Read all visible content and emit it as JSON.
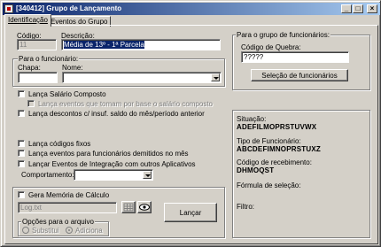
{
  "window": {
    "title": "[340412] Grupo de Lançamento",
    "minimize_symbol": "_",
    "maximize_symbol": "□",
    "close_symbol": "×"
  },
  "tabs": [
    {
      "label": "Identificação"
    },
    {
      "label": "Eventos do Grupo"
    }
  ],
  "form": {
    "codigo_label": "Código:",
    "codigo_value": "11",
    "descricao_label": "Descrição:",
    "descricao_value": "Média de 13º - 1ª Parcela",
    "funcionario_group_title": "Para o funcionário:",
    "chapa_label": "Chapa:",
    "chapa_value": "",
    "nome_label": "Nome:",
    "nome_value": ""
  },
  "checks": {
    "salario_composto": "Lança Salário Composto",
    "eventos_base": "Lança eventos que tomam por base o salário composto",
    "descontos": "Lança descontos c/ insuf. saldo do mês/período anterior",
    "codigos_fixos": "Lança códigos fixos",
    "demitidos": "Lança eventos para funcionários demitidos no mês",
    "integracao": "Lançar Eventos de Integração com outros Aplicativos",
    "comportamento_label": "Comportamento:",
    "comportamento_value": ""
  },
  "memoria": {
    "gera_label": "Gera Memória de Cálculo",
    "file_value": "Log.txt",
    "opcoes_title": "Opções para o arquivo",
    "substitui": "Substitui",
    "adiciona": "Adiciona",
    "lancar_button": "Lançar"
  },
  "grupo_func": {
    "group_title": "Para o grupo de funcionários:",
    "codigo_quebra_label": "Código de Quebra:",
    "codigo_quebra_value": "?????",
    "selecao_button": "Seleção de funcionários"
  },
  "info": {
    "situacao_label": "Situação:",
    "situacao_value": "ADEFILMOPRSTUVWX",
    "tipo_label": "Tipo de Funcionário:",
    "tipo_value": "ABCDEFIMNOPRSTUXZ",
    "recebimento_label": "Código de recebimento:",
    "recebimento_value": "DHMOQST",
    "formula_label": "Fórmula de seleção:",
    "filtro_label": "Filtro:"
  }
}
